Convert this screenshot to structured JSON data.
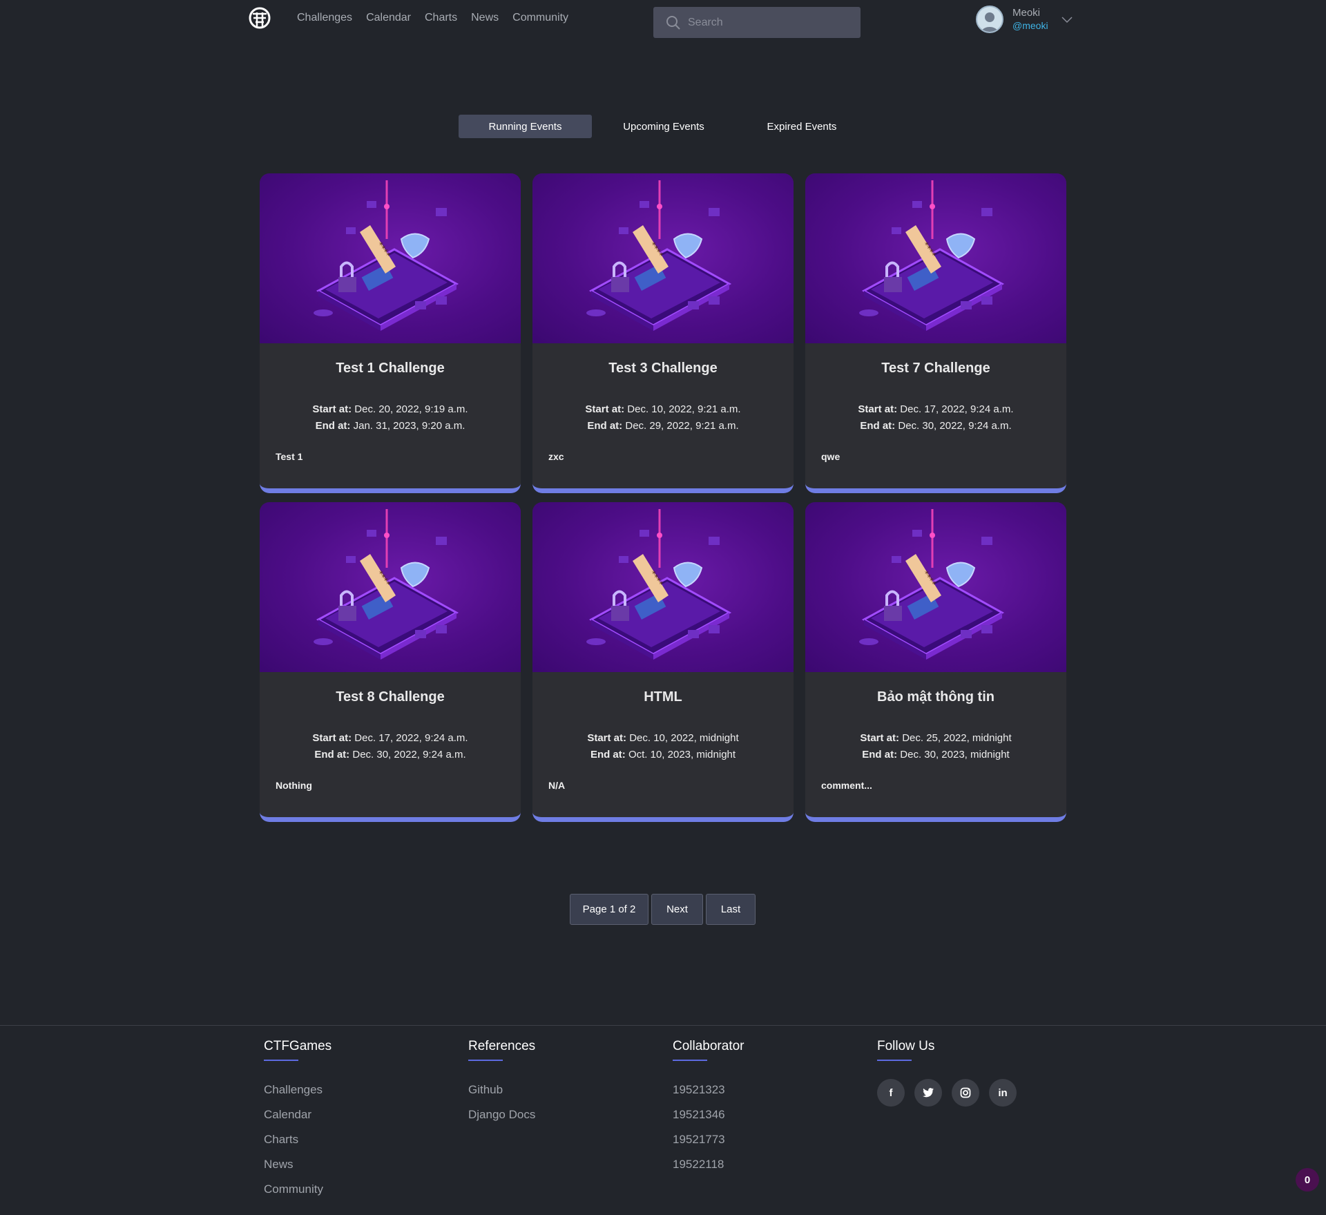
{
  "header": {
    "nav": [
      "Challenges",
      "Calendar",
      "Charts",
      "News",
      "Community"
    ],
    "search_placeholder": "Search",
    "user": {
      "name": "Meoki",
      "handle": "@meoki"
    }
  },
  "tabs": [
    {
      "label": "Running Events",
      "active": true
    },
    {
      "label": "Upcoming Events",
      "active": false
    },
    {
      "label": "Expired Events",
      "active": false
    }
  ],
  "start_label": "Start at:",
  "end_label": "End at:",
  "cards": [
    {
      "title": "Test 1 Challenge",
      "start": "Dec. 20, 2022, 9:19 a.m.",
      "end": "Jan. 31, 2023, 9:20 a.m.",
      "description": "Test 1"
    },
    {
      "title": "Test 3 Challenge",
      "start": "Dec. 10, 2022, 9:21 a.m.",
      "end": "Dec. 29, 2022, 9:21 a.m.",
      "description": "zxc"
    },
    {
      "title": "Test 7 Challenge",
      "start": "Dec. 17, 2022, 9:24 a.m.",
      "end": "Dec. 30, 2022, 9:24 a.m.",
      "description": "qwe"
    },
    {
      "title": "Test 8 Challenge",
      "start": "Dec. 17, 2022, 9:24 a.m.",
      "end": "Dec. 30, 2022, 9:24 a.m.",
      "description": "Nothing"
    },
    {
      "title": "HTML",
      "start": "Dec. 10, 2022, midnight",
      "end": "Oct. 10, 2023, midnight",
      "description": "N/A"
    },
    {
      "title": "Bảo mật thông tin",
      "start": "Dec. 25, 2022, midnight",
      "end": "Dec. 30, 2023, midnight",
      "description": "comment..."
    }
  ],
  "pagination": {
    "page_info": "Page 1 of 2",
    "next": "Next",
    "last": "Last"
  },
  "footer": {
    "columns": [
      {
        "heading": "CTFGames",
        "links": [
          "Challenges",
          "Calendar",
          "Charts",
          "News",
          "Community"
        ]
      },
      {
        "heading": "References",
        "links": [
          "Github",
          "Django Docs"
        ]
      },
      {
        "heading": "Collaborator",
        "links": [
          "19521323",
          "19521346",
          "19521773",
          "19522118"
        ]
      }
    ],
    "follow": {
      "heading": "Follow Us",
      "socials": [
        {
          "icon": "facebook-icon",
          "glyph": "f"
        },
        {
          "icon": "twitter-icon",
          "glyph": "t"
        },
        {
          "icon": "instagram-icon",
          "glyph": "◎"
        },
        {
          "icon": "linkedin-icon",
          "glyph": "in"
        }
      ]
    }
  },
  "notification_count": "0",
  "colors": {
    "accent": "#6f7de4",
    "background": "#22252b",
    "card": "#2d2e33",
    "handle": "#3fb4e6"
  }
}
